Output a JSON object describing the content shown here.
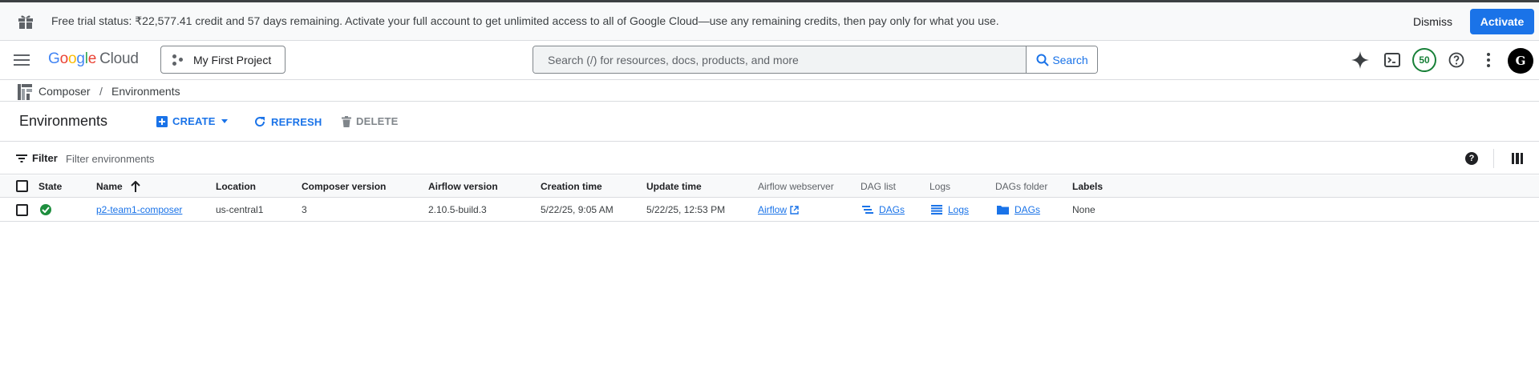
{
  "banner": {
    "message": "Free trial status: ₹22,577.41 credit and 57 days remaining. Activate your full account to get unlimited access to all of Google Cloud—use any remaining credits, then pay only for what you use.",
    "dismiss_label": "Dismiss",
    "activate_label": "Activate",
    "icon": "gift-icon"
  },
  "header": {
    "logo_letters": [
      "G",
      "o",
      "o",
      "g",
      "l",
      "e"
    ],
    "logo_product": "Cloud",
    "project_label": "My First Project",
    "search_placeholder": "Search (/) for resources, docs, products, and more",
    "search_button": "Search",
    "notifications_count": "50",
    "avatar_initials": "G",
    "icons": [
      "menu-icon",
      "gemini-sparkle-icon",
      "cloud-shell-icon",
      "help-icon",
      "more-vert-icon"
    ]
  },
  "breadcrumb": {
    "items": [
      "Composer",
      "Environments"
    ],
    "separator": "/"
  },
  "toolbar": {
    "title": "Environments",
    "create_label": "CREATE",
    "refresh_label": "REFRESH",
    "delete_label": "DELETE"
  },
  "filter": {
    "label": "Filter",
    "placeholder": "Filter environments"
  },
  "table": {
    "columns": [
      "State",
      "Name",
      "Location",
      "Composer version",
      "Airflow version",
      "Creation time",
      "Update time",
      "Airflow webserver",
      "DAG list",
      "Logs",
      "DAGs folder",
      "Labels"
    ],
    "sort_column": "Name",
    "sort_direction": "ascending",
    "rows": [
      {
        "state": "running",
        "name": "p2-team1-composer",
        "location": "us-central1",
        "composer_version": "3",
        "airflow_version": "2.10.5-build.3",
        "creation_time": "5/22/25, 9:05 AM",
        "update_time": "5/22/25, 12:53 PM",
        "webserver": "Airflow",
        "dag_list": "DAGs",
        "logs": "Logs",
        "dags_folder": "DAGs",
        "labels": "None"
      }
    ]
  },
  "colors": {
    "accent": "#1a73e8",
    "success": "#1e8e3e",
    "border": "#dadce0"
  }
}
